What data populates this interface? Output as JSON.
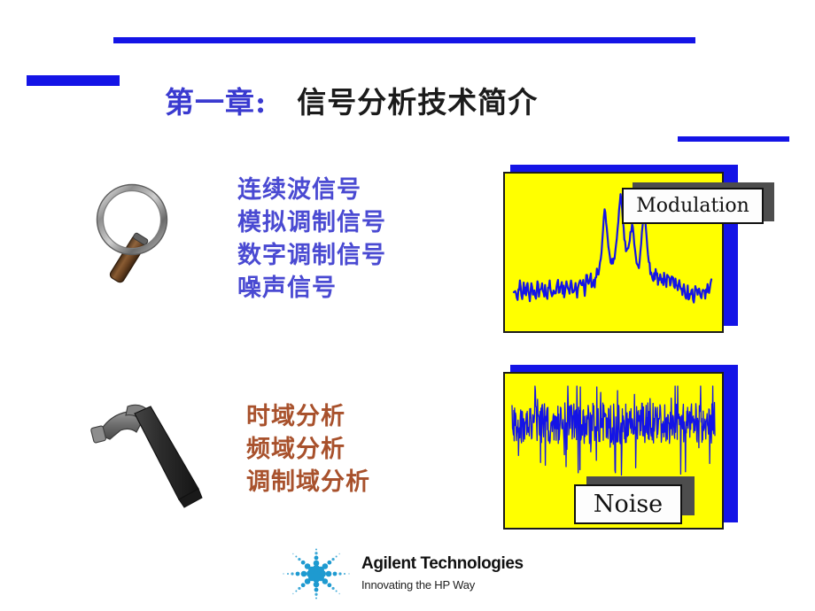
{
  "slide": {
    "background_color": "#ffffff",
    "accent_blue": "#1414e6",
    "panel_yellow": "#ffff00",
    "trace_blue": "#1414e6",
    "signal_text_color": "#4a4ad2",
    "analysis_text_color": "#a8512c"
  },
  "title": {
    "chapter": "第一章:",
    "heading": "信号分析技术简介"
  },
  "signal_list": {
    "icon": "magnifier-icon",
    "items": [
      "连续波信号",
      "模拟调制信号",
      "数字调制信号",
      "噪声信号"
    ]
  },
  "analysis_list": {
    "icon": "hammer-icon",
    "items": [
      "时域分析",
      "频域分析",
      "调制域分析"
    ]
  },
  "panels": [
    {
      "name": "modulation",
      "caption": "Modulation",
      "chart_type": "spectrum"
    },
    {
      "name": "noise",
      "caption": "Noise",
      "chart_type": "noise"
    }
  ],
  "logo": {
    "name": "Agilent Technologies",
    "tagline": "Innovating the HP Way",
    "mark_color": "#1e9ad0"
  },
  "chart_data": [
    {
      "type": "line",
      "name": "modulation-spectrum",
      "title": "Modulation",
      "xlabel": "",
      "ylabel": "",
      "grid": false,
      "legend": "none",
      "x": [
        0,
        1,
        2,
        3,
        4,
        5,
        6,
        7,
        8,
        9,
        10,
        11,
        12,
        13,
        14,
        15,
        16,
        17,
        18,
        19,
        20,
        21,
        22,
        23,
        24,
        25,
        26,
        27,
        28,
        29,
        30,
        31,
        32,
        33,
        34,
        35,
        36,
        37,
        38,
        39,
        40,
        41,
        42,
        43,
        44,
        45,
        46,
        47,
        48,
        49,
        50,
        51,
        52,
        53,
        54,
        55,
        56,
        57,
        58,
        59,
        60,
        61,
        62,
        63,
        64,
        65,
        66,
        67,
        68,
        69,
        70,
        71,
        72,
        73,
        74,
        75,
        76,
        77,
        78,
        79,
        80,
        81,
        82,
        83,
        84,
        85,
        86,
        87,
        88,
        89,
        90,
        91,
        92,
        93,
        94,
        95,
        96,
        97,
        98,
        99,
        100
      ],
      "values": [
        20,
        24,
        17,
        27,
        16,
        26,
        19,
        30,
        15,
        24,
        21,
        16,
        26,
        18,
        28,
        17,
        22,
        19,
        27,
        15,
        25,
        20,
        31,
        18,
        26,
        22,
        17,
        28,
        21,
        33,
        20,
        26,
        19,
        31,
        23,
        27,
        21,
        36,
        26,
        31,
        24,
        28,
        34,
        30,
        45,
        62,
        85,
        70,
        52,
        44,
        40,
        47,
        58,
        74,
        96,
        78,
        60,
        50,
        55,
        63,
        72,
        55,
        42,
        38,
        47,
        68,
        86,
        64,
        46,
        38,
        33,
        30,
        36,
        29,
        34,
        26,
        31,
        23,
        36,
        28,
        33,
        25,
        30,
        21,
        26,
        18,
        24,
        16,
        22,
        13,
        20,
        15,
        26,
        18,
        24,
        14,
        21,
        17,
        27,
        20,
        31
      ],
      "ylim": [
        0,
        100
      ]
    },
    {
      "type": "line",
      "name": "noise-waveform",
      "title": "Noise",
      "xlabel": "",
      "ylabel": "",
      "grid": false,
      "legend": "none",
      "description": "Dense random noise trace concentrated in the upper third of the panel",
      "ylim": [
        -1,
        1
      ]
    }
  ]
}
